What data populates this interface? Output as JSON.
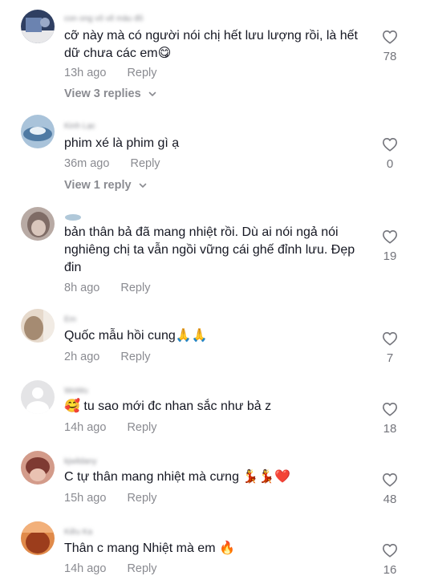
{
  "comments": [
    {
      "username": "con ong vô vẽ màu đỏ",
      "text": "cỡ này mà có người nói chị hết lưu lượng rồi, là hết dữ chưa các em😋",
      "time": "13h ago",
      "reply": "Reply",
      "likes": "78",
      "view_replies": "View 3 replies",
      "avatar_color": "#3c4f7a"
    },
    {
      "username": "Kinh Lạc",
      "text": "phim xé là phim gì ạ",
      "time": "36m ago",
      "reply": "Reply",
      "likes": "0",
      "view_replies": "View 1 reply",
      "avatar_color": "#7fa4c4"
    },
    {
      "username": "",
      "text": "bản thân bả đã mang nhiệt rồi. Dù ai nói ngả nói nghiêng chị ta vẫn ngồi vững cái ghế đỉnh lưu. Đẹp đin",
      "time": "8h ago",
      "reply": "Reply",
      "likes": "19",
      "avatar_color": "#9a8a84"
    },
    {
      "username": "Em",
      "text": "Quốc mẫu hồi cung🙏🙏",
      "time": "2h ago",
      "reply": "Reply",
      "likes": "7",
      "avatar_color": "#c9b7a3"
    },
    {
      "username": "WoWu",
      "text": "🥰 tu sao mới đc nhan sắc như bả z",
      "time": "14h ago",
      "reply": "Reply",
      "likes": "18",
      "avatar_color": "#e3e3e3"
    },
    {
      "username": "kjwildany",
      "text": "C tự thân mang nhiệt mà cưng 💃💃❤️",
      "time": "15h ago",
      "reply": "Reply",
      "likes": "48",
      "avatar_color": "#b26a5a"
    },
    {
      "username": "Kiều Ka",
      "text": "Thân c mang Nhiệt mà em 🔥",
      "time": "14h ago",
      "reply": "Reply",
      "likes": "16",
      "avatar_color": "#c8602e"
    }
  ],
  "colors": {
    "text": "#161823",
    "muted": "#8a8b91",
    "heart_stroke": "#73747b"
  }
}
